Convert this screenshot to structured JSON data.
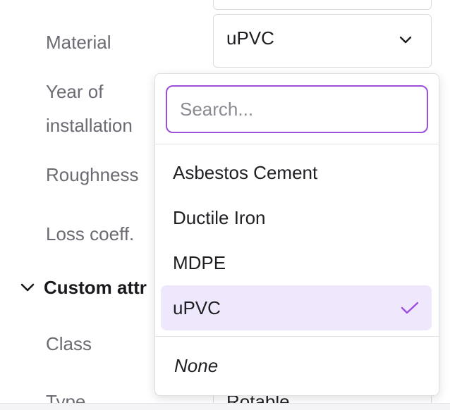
{
  "form": {
    "material_label": "Material",
    "material_value": "uPVC",
    "year_label_line1": "Year of",
    "year_label_line2": "installation",
    "roughness_label": "Roughness",
    "loss_coeff_label": "Loss coeff.",
    "custom_section_label": "Custom attr",
    "class_label": "Class",
    "type_label": "Type",
    "type_value": "Rotable"
  },
  "dropdown": {
    "search_placeholder": "Search...",
    "options": [
      {
        "label": "Asbestos Cement",
        "selected": false
      },
      {
        "label": "Ductile Iron",
        "selected": false
      },
      {
        "label": "MDPE",
        "selected": false
      },
      {
        "label": "uPVC",
        "selected": true
      }
    ],
    "none_label": "None"
  },
  "colors": {
    "accent": "#9d4ede",
    "selected_bg": "#efe7fb",
    "label_text": "#6b6b73"
  },
  "icons": {
    "select_chevron": "chevron-down-icon",
    "section_toggle": "chevron-down-icon",
    "selected_marker": "check-icon"
  }
}
